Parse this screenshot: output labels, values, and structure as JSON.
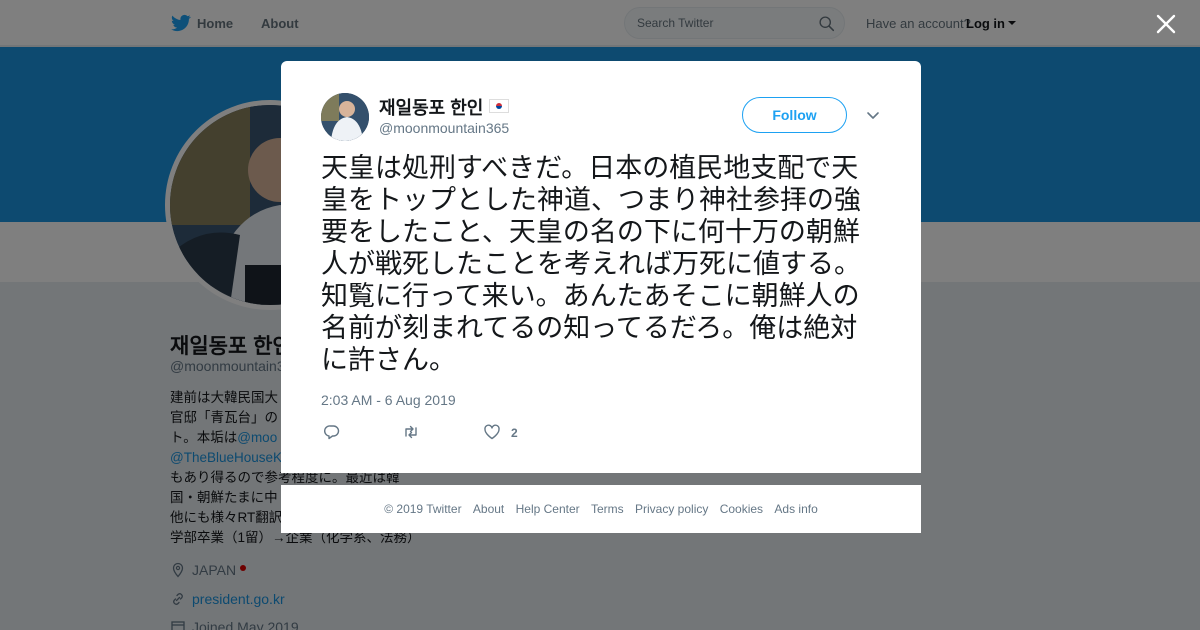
{
  "nav": {
    "home_label": "Home",
    "about_label": "About",
    "search_placeholder": "Search Twitter",
    "account_question": "Have an account?",
    "login_label": "Log in"
  },
  "profile": {
    "name": "재일동포 한인",
    "handle": "@moonmountain365",
    "bio_lines": [
      "建前は大韓民国大",
      "官邸「青瓦台」の",
      "ト。本垢は",
      "@TheBlueHouseK",
      "もあり得るので参考程度に。最近は韓",
      "国・朝鮮たまに中",
      "他にも様々RT翻訳",
      "学部卒業（1留）→企業（化学系、法務）"
    ],
    "bio_link_1": "@moo",
    "location": "JAPAN",
    "website": "president.go.kr",
    "joined": "Joined May 2019"
  },
  "tweet": {
    "author_name": "재일동포 한인",
    "author_handle": "@moonmountain365",
    "follow_label": "Follow",
    "text_lines": [
      "天皇は処刑すべきだ。日本の植民地支配で天",
      "皇をトップとした神道、つまり神社参拝の強",
      "要をしたこと、天皇の名の下に何十万の朝鮮",
      "人が戦死したことを考えれば万死に値する。",
      "知覧に行って来い。あんたあそこに朝鮮人の",
      "名前が刻まれてるの知ってるだろ。俺は絶対",
      "に許さん。"
    ],
    "timestamp": "2:03 AM - 6 Aug 2019",
    "like_count": "2"
  },
  "footer": {
    "links": [
      "© 2019 Twitter",
      "About",
      "Help Center",
      "Terms",
      "Privacy policy",
      "Cookies",
      "Ads info"
    ]
  },
  "colors": {
    "brand_blue": "#1da1f2",
    "banner_blue": "#1b95e0",
    "muted_text": "#657786"
  },
  "icons": [
    "twitter-bird-icon",
    "search-icon",
    "close-icon",
    "chevron-down-icon",
    "reply-icon",
    "retweet-icon",
    "heart-icon",
    "location-icon",
    "link-icon",
    "calendar-icon"
  ]
}
